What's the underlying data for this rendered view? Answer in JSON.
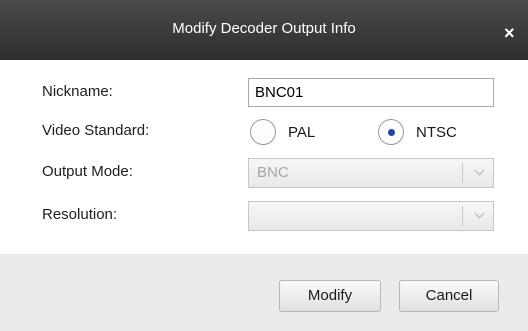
{
  "window": {
    "title": "Modify Decoder Output Info",
    "close_glyph": "×"
  },
  "form": {
    "nickname_label": "Nickname:",
    "nickname_value": "BNC01",
    "video_standard_label": "Video Standard:",
    "video_standard_options": [
      "PAL",
      "NTSC"
    ],
    "video_standard_selected": "NTSC",
    "output_mode_label": "Output Mode:",
    "output_mode_value": "BNC",
    "output_mode_disabled": true,
    "resolution_label": "Resolution:",
    "resolution_value": "",
    "resolution_disabled": true
  },
  "buttons": {
    "modify": "Modify",
    "cancel": "Cancel"
  },
  "colors": {
    "titlebar": "#3a3a3a",
    "radio_dot": "#1b48a8",
    "footer": "#ebebeb"
  }
}
